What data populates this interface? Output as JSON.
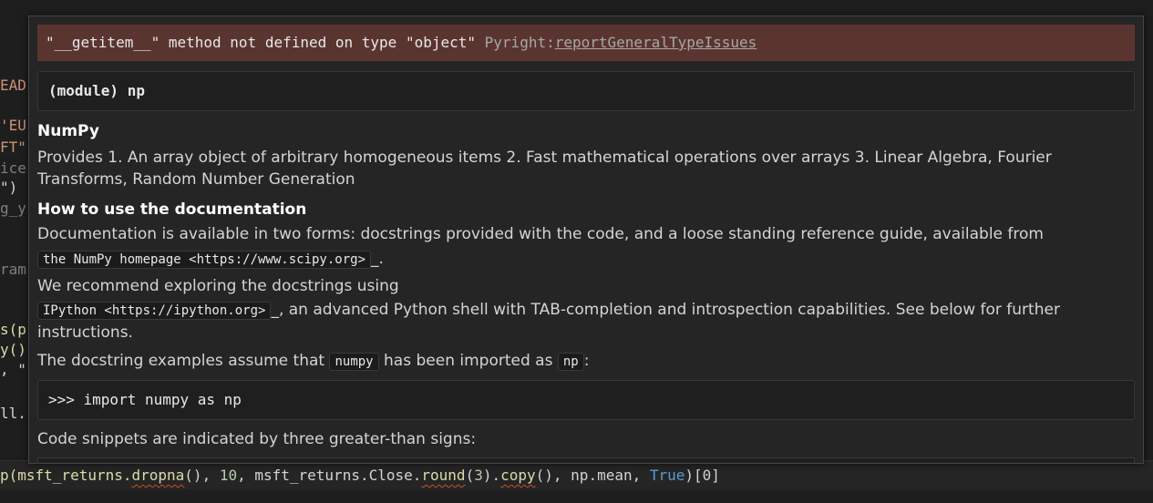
{
  "editor": {
    "left_fragments": [
      {
        "text": "EAD",
        "color": "#ce9178"
      },
      {
        "text": "'EU",
        "color": "#ce9178"
      },
      {
        "text": "FT\"",
        "color": "#ce9178"
      },
      {
        "text": "ice",
        "color": "#7f7f7f"
      },
      {
        "text": "\")",
        "color": "#d4d4d4"
      },
      {
        "text": "g_y",
        "color": "#7f7f7f"
      },
      {
        "text": "ram",
        "color": "#7f7f7f"
      },
      {
        "text": "s(p",
        "color": "#dcdcaa"
      },
      {
        "text": "y()",
        "color": "#dcdcaa"
      },
      {
        "text": ", \"",
        "color": "#d4d4d4"
      },
      {
        "text": "ll.",
        "color": "#d4d4d4"
      }
    ],
    "bottom_line": {
      "p1": "p(msft_returns.",
      "dropna": "dropna",
      "p2": "(), ",
      "n10": "10",
      "p3": ", msft_returns.Close.",
      "round": "round",
      "p4": "(",
      "n3": "3",
      "p5": ").",
      "copy": "copy",
      "p6": "(), np.mean, ",
      "true": "True",
      "p7": ")[0]"
    }
  },
  "hover": {
    "error": {
      "message": "\"__getitem__\" method not defined on type \"object\"",
      "source": "Pyright:",
      "rule_link": "reportGeneralTypeIssues"
    },
    "signature": "(module) np",
    "doc": {
      "title": "NumPy",
      "intro": "Provides 1. An array object of arbitrary homogeneous items 2. Fast mathematical operations over arrays 3. Linear Algebra, Fourier Transforms, Random Number Generation",
      "section_heading": "How to use the documentation",
      "para1": "Documentation is available in two forms: docstrings provided with the code, and a loose standing reference guide, available from",
      "homepage_code": "the NumPy homepage <https://www.scipy.org>",
      "homepage_suffix": "_.",
      "para2": "We recommend exploring the docstrings using",
      "ipython_code": "IPython <https://ipython.org>",
      "para2_suffix": "_, an advanced Python shell with TAB-completion and introspection capabilities. See below for further instructions.",
      "para3_prefix": "The docstring examples assume that",
      "numpy_code": "numpy",
      "para3_mid": "has been imported as",
      "np_code": "np",
      "para3_suffix": ":",
      "code_example": ">>> import numpy as np",
      "para4": "Code snippets are indicated by three greater-than signs:"
    }
  }
}
